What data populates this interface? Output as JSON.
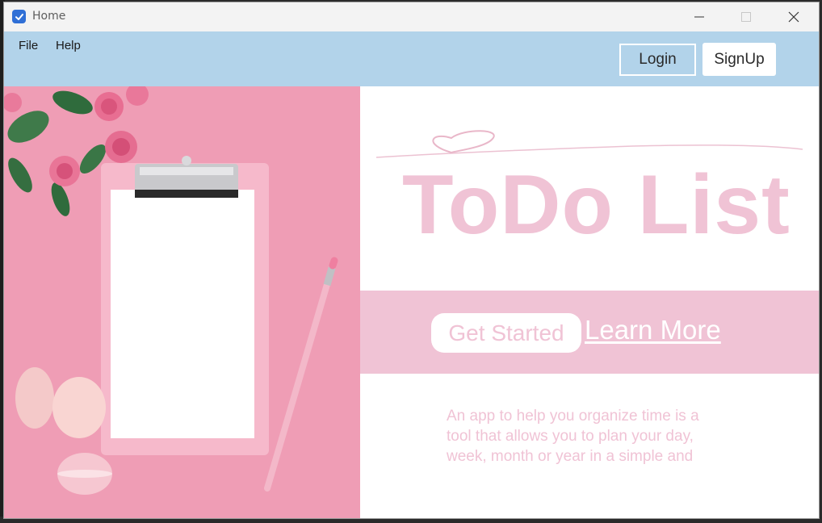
{
  "window": {
    "title": "Home",
    "icon": "check-app-icon"
  },
  "menubar": {
    "items": [
      {
        "label": "File"
      },
      {
        "label": "Help"
      }
    ],
    "login_label": "Login",
    "signup_label": "SignUp"
  },
  "hero": {
    "image_description_icon": "clipboard-flowers-image"
  },
  "main": {
    "title": "ToDo List",
    "get_started_label": "Get Started",
    "learn_more_label": "Learn More",
    "description": "An app to help you organize time is a tool that allows you to plan your day, week, month or year in a simple and"
  },
  "colors": {
    "menubar_bg": "#b2d3ea",
    "accent_pink": "#f0c3d5",
    "hero_bg": "#ef9db5"
  }
}
